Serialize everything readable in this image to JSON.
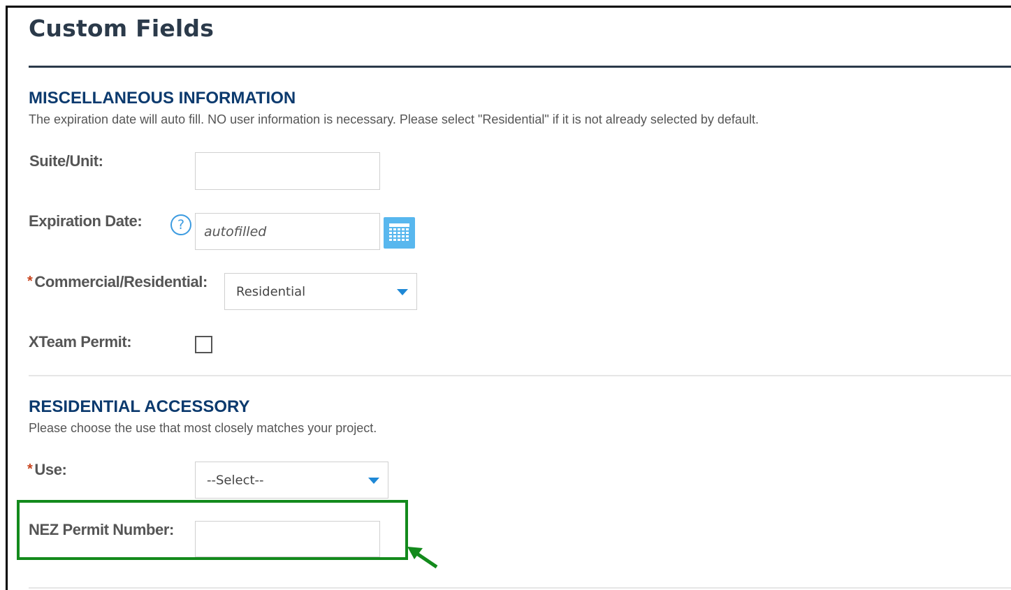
{
  "page": {
    "title": "Custom Fields"
  },
  "misc_section": {
    "title": "MISCELLANEOUS INFORMATION",
    "description": "The expiration date will auto fill. NO user information is necessary. Please select \"Residential\" if it is not already selected by default.",
    "fields": {
      "suite_unit": {
        "label": "Suite/Unit:",
        "value": ""
      },
      "expiration_date": {
        "label": "Expiration Date:",
        "placeholder": "autofilled",
        "help_icon": "?"
      },
      "commercial_residential": {
        "required_marker": "*",
        "label": "Commercial/Residential:",
        "selected": "Residential"
      },
      "xteam_permit": {
        "label": "XTeam Permit:",
        "checked": false
      }
    }
  },
  "residential_section": {
    "title": "RESIDENTIAL ACCESSORY",
    "description": "Please choose the use that most closely matches your project.",
    "fields": {
      "use": {
        "required_marker": "*",
        "label": "Use:",
        "selected": "--Select--"
      },
      "nez_permit_number": {
        "label": "NEZ Permit Number:",
        "value": ""
      }
    }
  },
  "colors": {
    "section_title": "#0c3a6e",
    "required_marker": "#c8451f",
    "calendar_button": "#58b7ee",
    "dropdown_caret": "#1e88d6",
    "highlight_box": "#138a1c"
  },
  "icons": {
    "help": "question-circle-icon",
    "calendar": "calendar-icon",
    "dropdown": "caret-down-icon",
    "annotation": "arrow-icon"
  }
}
